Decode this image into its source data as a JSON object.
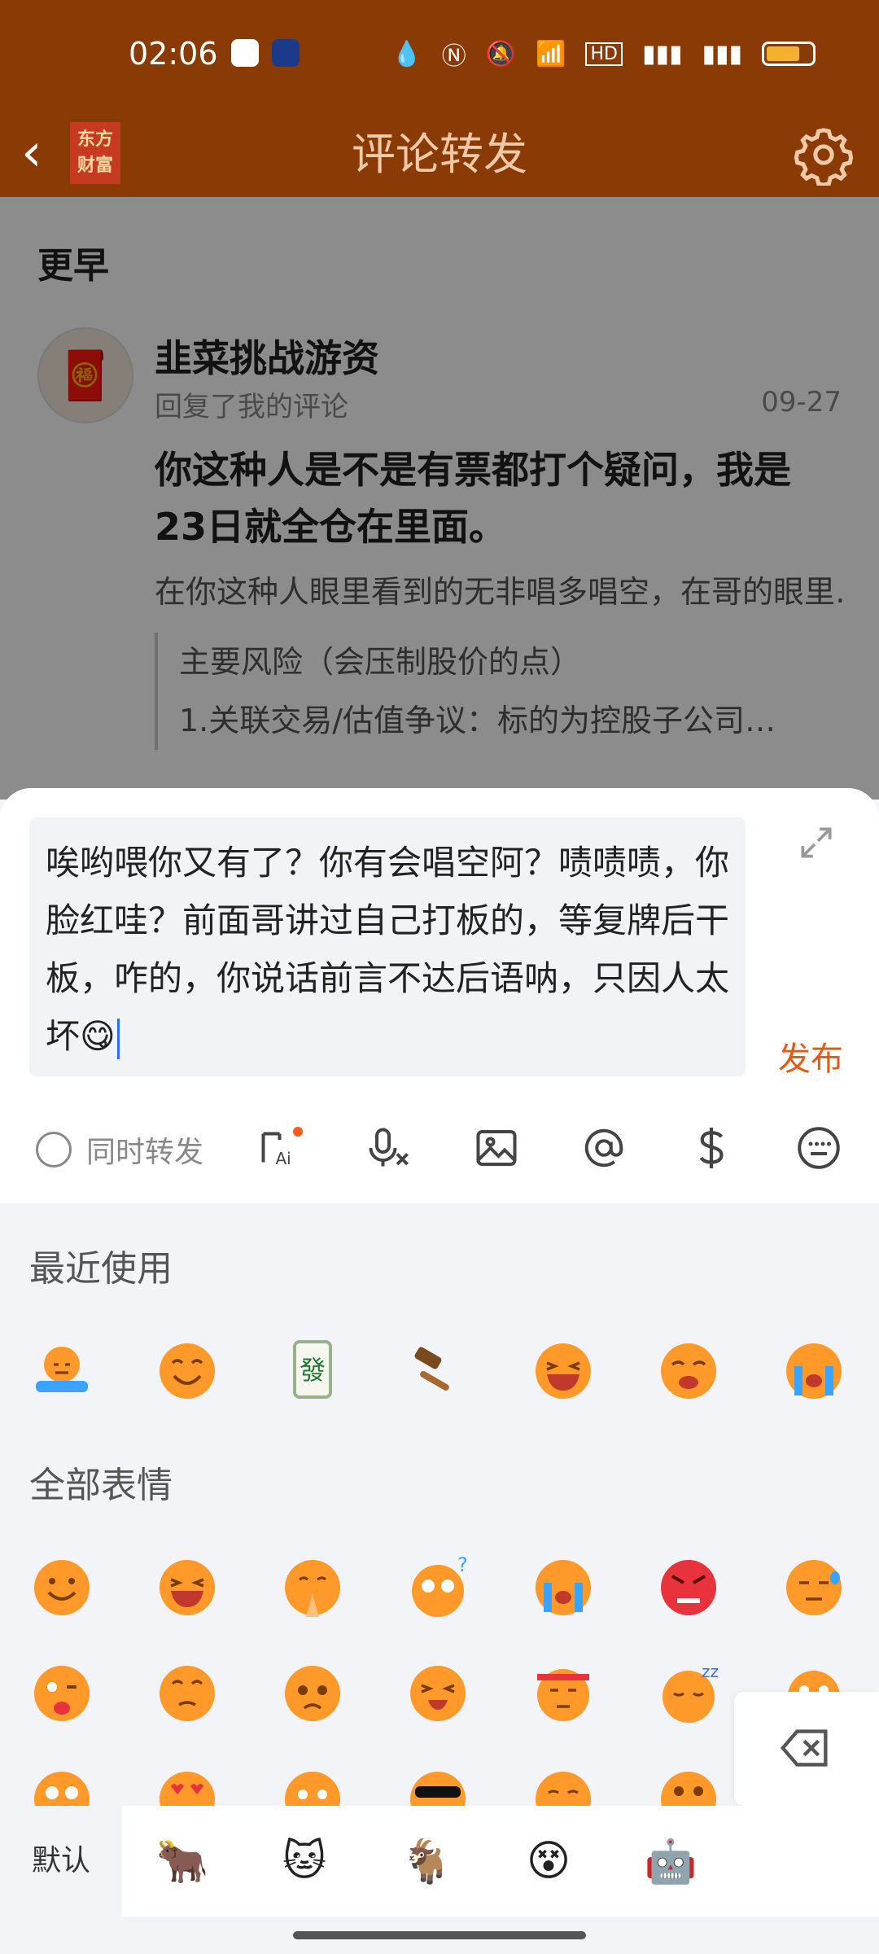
{
  "status": {
    "time": "02:06",
    "icons": [
      "notification-drop-icon",
      "nfc-icon",
      "bell-off-icon",
      "wifi-icon",
      "hd-icon",
      "signal-4g-icon",
      "signal-4g-icon",
      "battery-icon"
    ]
  },
  "header": {
    "logo": "东方财富",
    "title": "评论转发"
  },
  "feed": {
    "section": "更早",
    "item": {
      "user": "韭菜挑战游资",
      "action": "回复了我的评论",
      "date": "09-27",
      "reply": "你这种人是不是有票都打个疑问，我是23日就全仓在里面。",
      "origin": "在你这种人眼里看到的无非唱多唱空，在哥的眼里……",
      "quote_lines": [
        "主要风险（会压制股价的点）",
        "1.关联交易/估值争议：标的为控股子公司…"
      ]
    }
  },
  "composer": {
    "text": "唉哟喂你又有了？你有会唱空阿？啧啧啧，你脸红哇？前面哥讲过自己打板的，等复牌后干板，咋的，你说话前言不达后语呐，只因人太坏😋",
    "publish": "发布",
    "sync_label": "同时转发"
  },
  "emoji_panel": {
    "recent_label": "最近使用",
    "all_label": "全部表情",
    "tabs": [
      "默认"
    ]
  },
  "colors": {
    "header_bg": "#8a3b05",
    "accent": "#e35a14",
    "emoji_face": "#ff9a2a"
  }
}
